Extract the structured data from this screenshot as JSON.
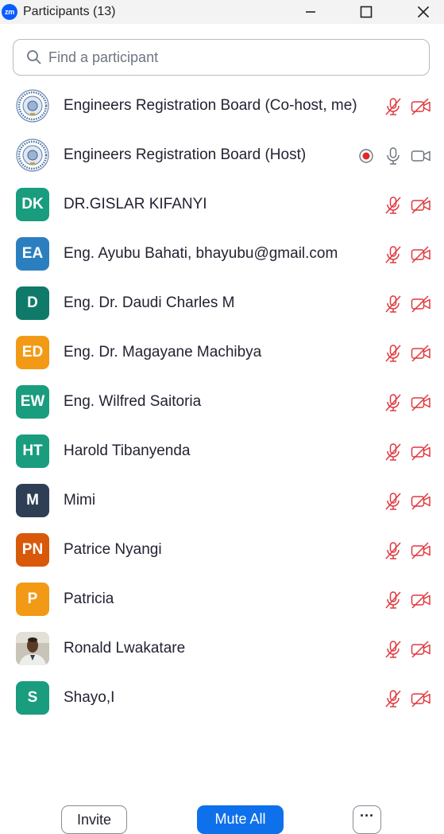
{
  "window": {
    "app_logo": "zm",
    "title": "Participants (13)",
    "controls": [
      "minimize-icon",
      "maximize-icon",
      "close-icon"
    ]
  },
  "search": {
    "placeholder": "Find a participant",
    "value": ""
  },
  "participants": [
    {
      "name": "Engineers Registration Board (Co-host, me)",
      "avatar_type": "logo",
      "recording": false,
      "mic": "muted",
      "camera": "off"
    },
    {
      "name": "Engineers Registration Board (Host)",
      "avatar_type": "logo",
      "recording": true,
      "mic": "on",
      "camera": "on"
    },
    {
      "name": "DR.GISLAR KIFANYI",
      "initials": "DK",
      "avatar_color": "#1a9c7e",
      "mic": "muted",
      "camera": "off"
    },
    {
      "name": "Eng. Ayubu Bahati, bhayubu@gmail.com",
      "initials": "EA",
      "avatar_color": "#2c7fbf",
      "mic": "muted",
      "camera": "off"
    },
    {
      "name": "Eng. Dr. Daudi Charles M",
      "initials": "D",
      "avatar_color": "#0f7a6a",
      "mic": "muted",
      "camera": "off"
    },
    {
      "name": "Eng. Dr. Magayane Machibya",
      "initials": "ED",
      "avatar_color": "#f29a16",
      "mic": "muted",
      "camera": "off"
    },
    {
      "name": "Eng. Wilfred Saitoria",
      "initials": "EW",
      "avatar_color": "#1a9c7e",
      "mic": "muted",
      "camera": "off"
    },
    {
      "name": "Harold Tibanyenda",
      "initials": "HT",
      "avatar_color": "#1a9c7e",
      "mic": "muted",
      "camera": "off"
    },
    {
      "name": "Mimi",
      "initials": "M",
      "avatar_color": "#2e3e55",
      "mic": "muted",
      "camera": "off"
    },
    {
      "name": "Patrice Nyangi",
      "initials": "PN",
      "avatar_color": "#d9590b",
      "mic": "muted",
      "camera": "off"
    },
    {
      "name": "Patricia",
      "initials": "P",
      "avatar_color": "#f29a16",
      "mic": "muted",
      "camera": "off"
    },
    {
      "name": "Ronald Lwakatare",
      "avatar_type": "photo",
      "mic": "muted",
      "camera": "off"
    },
    {
      "name": "Shayo,I",
      "initials": "S",
      "avatar_color": "#1a9c7e",
      "mic": "muted",
      "camera": "off"
    }
  ],
  "footer": {
    "invite_label": "Invite",
    "mute_all_label": "Mute All",
    "more_label": "···"
  },
  "colors": {
    "muted_red": "#e0383e",
    "primary_blue": "#0e71eb",
    "recording_red": "#e02828"
  }
}
